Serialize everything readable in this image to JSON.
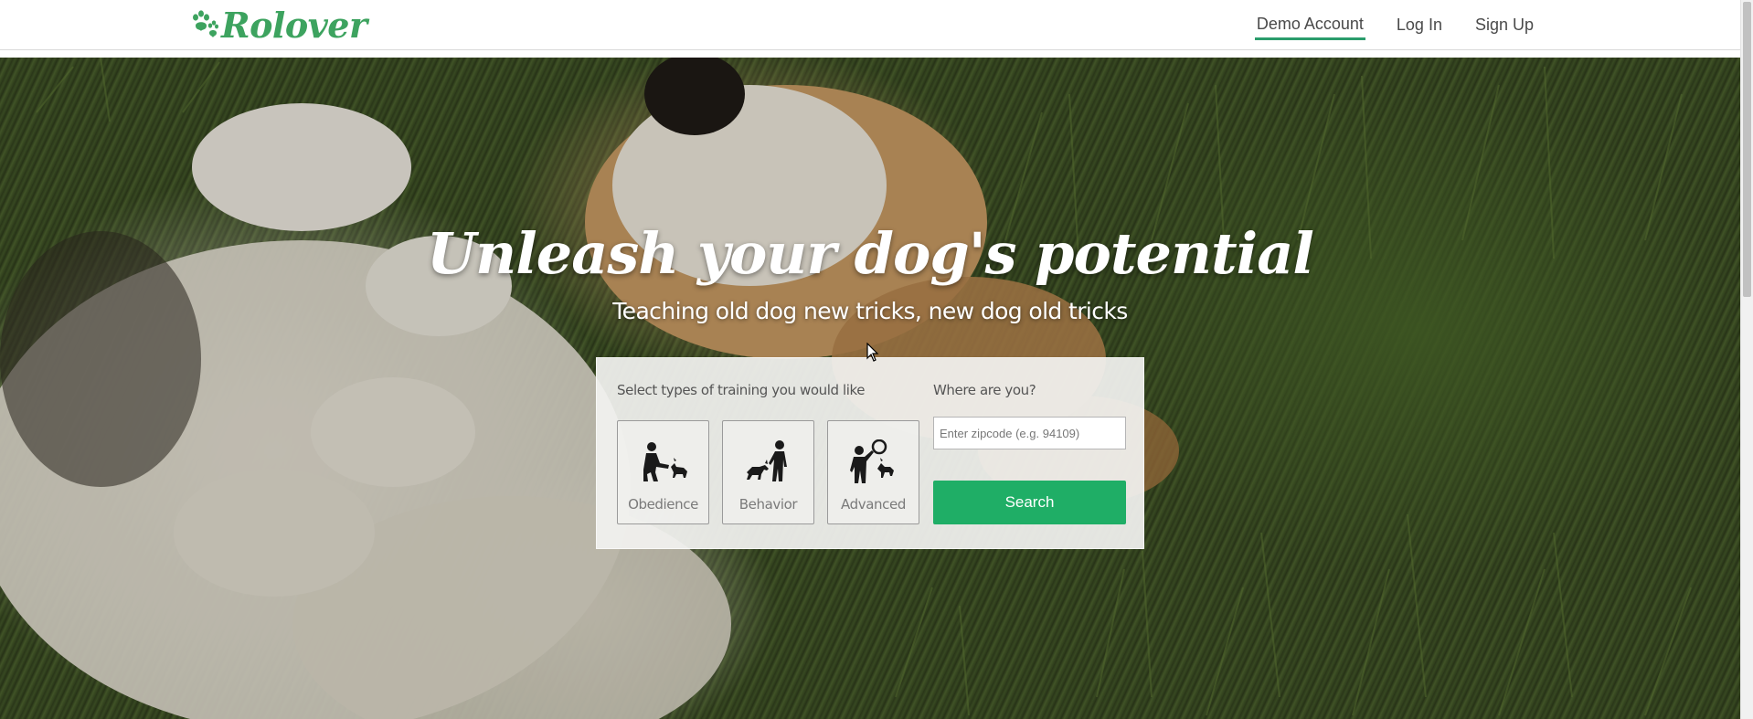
{
  "brand": {
    "name": "Rolover",
    "logo_icon": "paw-prints-icon",
    "accent_color": "#3da35f"
  },
  "nav": {
    "links": [
      {
        "label": "Demo Account",
        "active": true
      },
      {
        "label": "Log In",
        "active": false
      },
      {
        "label": "Sign Up",
        "active": false
      }
    ]
  },
  "hero": {
    "title": "Unleash your dog's potential",
    "subtitle": "Teaching old dog new tricks, new dog old tricks"
  },
  "search_panel": {
    "training_label": "Select types of training you would like",
    "where_label": "Where are you?",
    "options": [
      {
        "label": "Obedience",
        "icon": "obedience-icon"
      },
      {
        "label": "Behavior",
        "icon": "behavior-icon"
      },
      {
        "label": "Advanced",
        "icon": "advanced-icon"
      }
    ],
    "zip_placeholder": "Enter zipcode (e.g. 94109)",
    "zip_value": "",
    "search_label": "Search",
    "button_color": "#1fae66"
  }
}
